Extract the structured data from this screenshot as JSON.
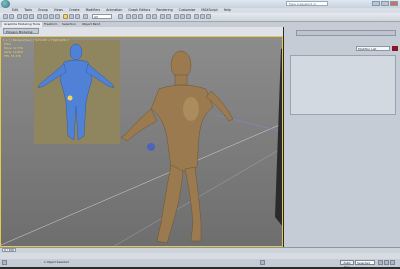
{
  "title_bar": {
    "search_placeholder": "Type a keyword or phrase"
  },
  "menu": {
    "items": [
      "Edit",
      "Tools",
      "Group",
      "Views",
      "Create",
      "Modifiers",
      "Animation",
      "Graph Editors",
      "Rendering",
      "Customize",
      "MAXScript",
      "Help"
    ]
  },
  "toolbar": {
    "selection_filter": "All"
  },
  "ribbon": {
    "tabs": [
      "Graphite Modeling Tools",
      "Freeform",
      "Selection",
      "Object Paint"
    ],
    "panel_label": "Polygon Modeling"
  },
  "viewport": {
    "label": "[ + ] [ Perspective ] [ Smooth + Highlights ]",
    "stats": [
      {
        "label": "Total",
        "value": ""
      },
      {
        "label": "Polys:",
        "value": "12,776"
      },
      {
        "label": "Verts:",
        "value": "12,800"
      },
      {
        "label": "FPS:",
        "value": "53.376"
      }
    ]
  },
  "command_panel": {
    "modifier_list": "Modifier List",
    "object_color": "#8b1526"
  },
  "time_slider": {
    "position": "0 / 100"
  },
  "status_bar": {
    "text": "1 Object Selected",
    "autokey_label": "Auto Key",
    "selection_dropdown": "Selected"
  },
  "colors": {
    "viewport_bg": "#7d7d7d",
    "character_skin": "#9a7a4e",
    "reference_figure": "#4f82d6",
    "active_border": "#e6c84a"
  }
}
